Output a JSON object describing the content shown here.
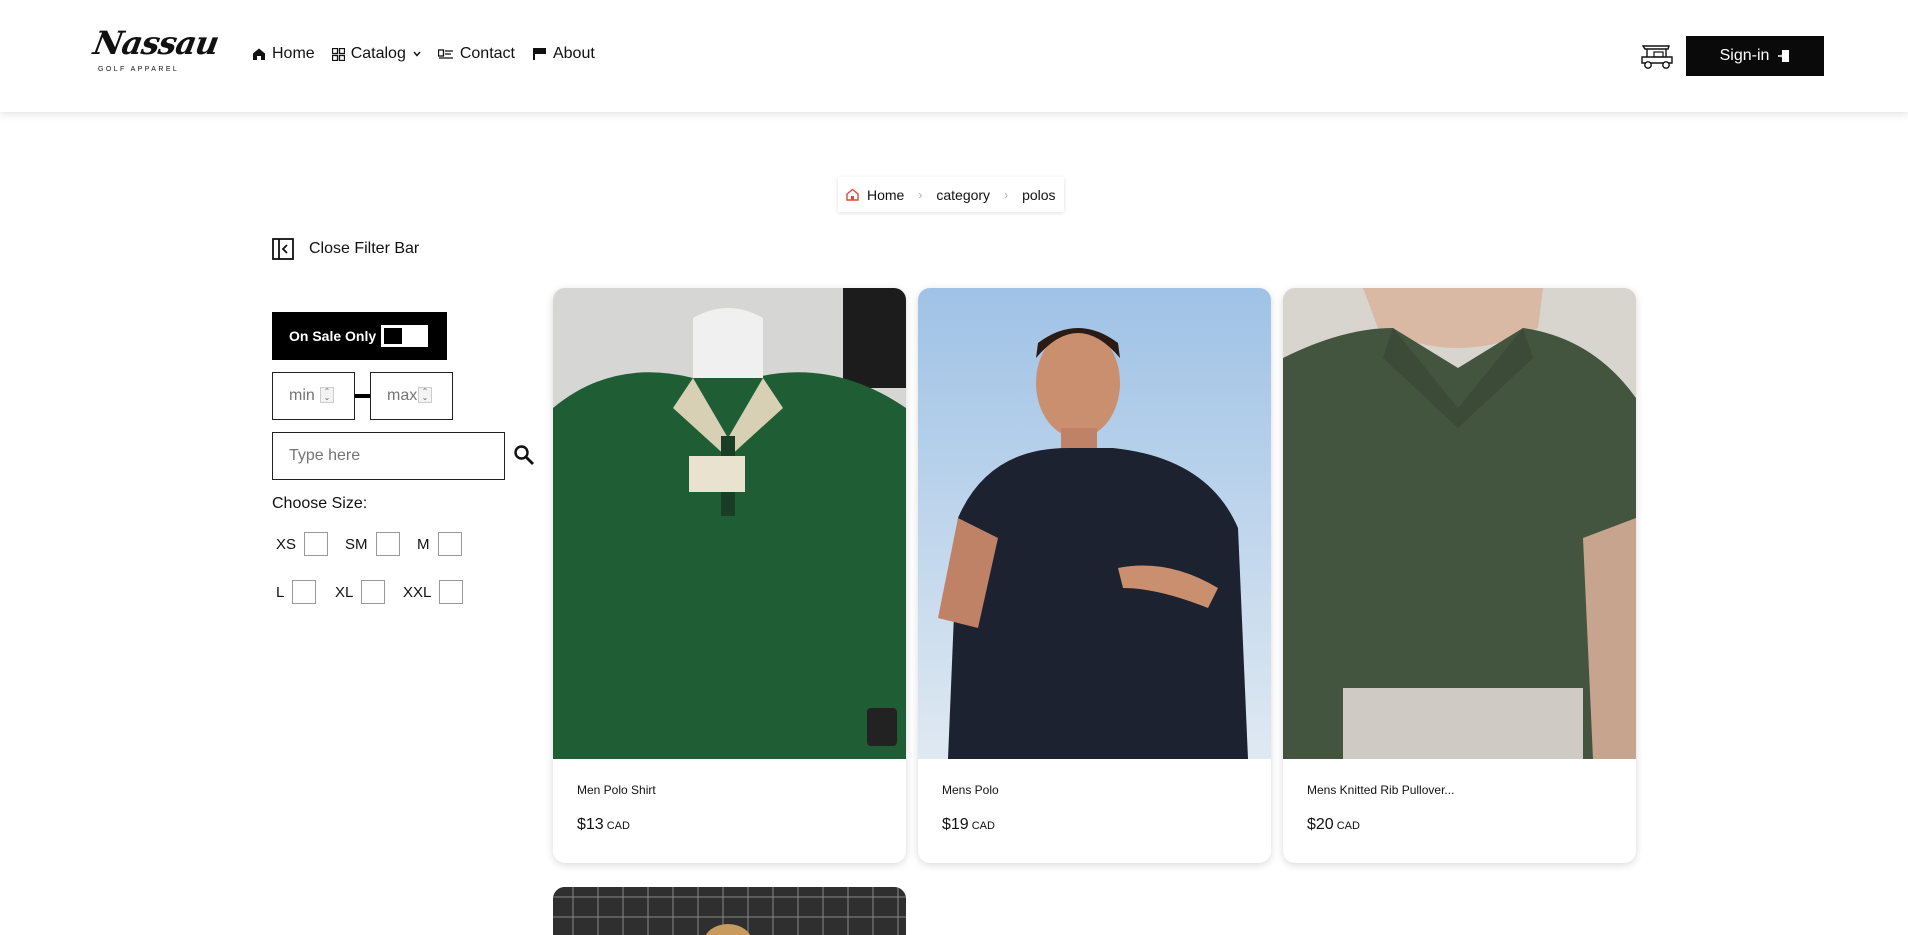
{
  "header": {
    "logo_text": "Nassau",
    "logo_subtext": "GOLF APPAREL",
    "nav": [
      {
        "label": "Home",
        "icon": "home-icon"
      },
      {
        "label": "Catalog",
        "icon": "grid-icon"
      },
      {
        "label": "Contact",
        "icon": "contact-card-icon"
      },
      {
        "label": "About",
        "icon": "flag-icon"
      }
    ],
    "cart_icon": "golf-cart-icon",
    "signin_label": "Sign-in"
  },
  "breadcrumb": [
    "Home",
    "category",
    "polos"
  ],
  "filter": {
    "close_label": "Close Filter Bar",
    "sale_label": "On Sale Only",
    "min_placeholder": "min",
    "max_placeholder": "max",
    "search_placeholder": "Type here",
    "size_label": "Choose Size:",
    "sizes": [
      "XS",
      "SM",
      "M",
      "L",
      "XL",
      "XXL"
    ]
  },
  "products": [
    {
      "name": "Men Polo Shirt",
      "price": "$13",
      "currency": "CAD"
    },
    {
      "name": "Mens Polo",
      "price": "$19",
      "currency": "CAD"
    },
    {
      "name": "Mens Knitted Rib Pullover...",
      "price": "$20",
      "currency": "CAD"
    }
  ],
  "colors": {
    "accent": "#0a0a0a",
    "background": "#ffffff"
  }
}
